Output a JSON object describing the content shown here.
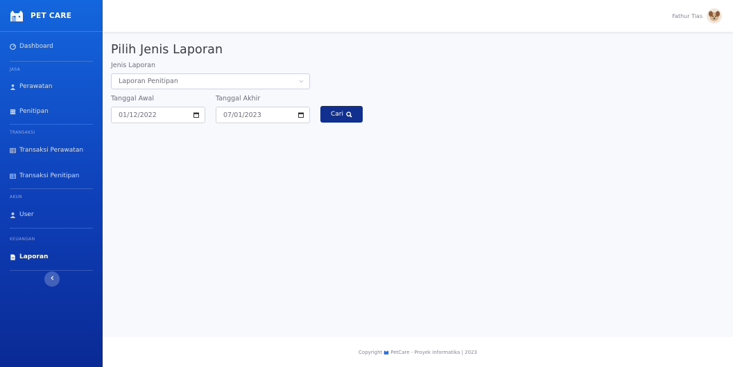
{
  "brand": {
    "name": "PET CARE"
  },
  "sidebar": {
    "dashboard": "Dashboard",
    "heading_jasa": "JASA",
    "perawatan": "Perawatan",
    "penitipan": "Penitipan",
    "heading_transaksi": "TRANSAKSI",
    "transaksi_perawatan": "Transaksi Perawatan",
    "transaksi_penitipan": "Transaksi Penitipan",
    "heading_akun": "AKUN",
    "user": "User",
    "heading_keuangan": "KEUANGAN",
    "laporan": "Laporan",
    "toggle_icon": "chevron-left-icon"
  },
  "topbar": {
    "user_name": "Fathur Tias"
  },
  "main": {
    "title": "Pilih Jenis Laporan",
    "jenis_label": "Jenis Laporan",
    "jenis_value": "Laporan Penitipan",
    "tanggal_awal_label": "Tanggal Awal",
    "tanggal_awal_value": "01/12/2022",
    "tanggal_akhir_label": "Tanggal Akhir",
    "tanggal_akhir_value": "07/01/2023",
    "search_label": "Cari"
  },
  "footer": {
    "prefix": "Copyright",
    "text": "PetCare - Proyek Informatika | 2023"
  },
  "colors": {
    "sidebar_top": "#1466de",
    "sidebar_bottom": "#0a2a95",
    "button": "#112f8f",
    "background": "#f8f9fc"
  }
}
